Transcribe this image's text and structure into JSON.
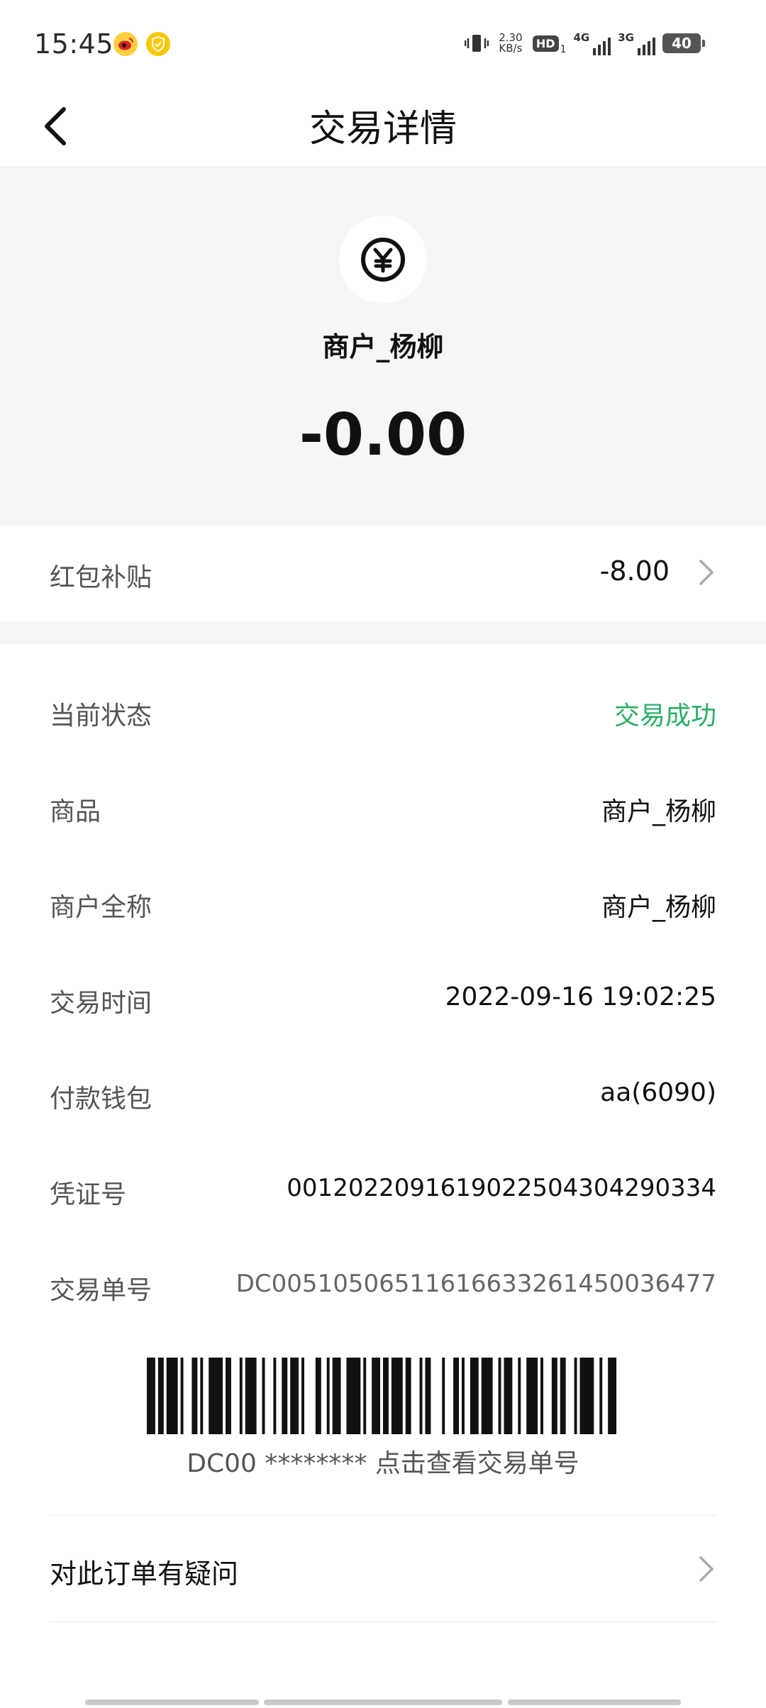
{
  "status_bar": {
    "time": "15:45",
    "net_speed_value": "2.30",
    "net_speed_unit": "KB/s",
    "hd_label": "HD",
    "hd_sub": "1",
    "signal1_label": "4G",
    "signal2_label": "3G",
    "battery": "40"
  },
  "nav": {
    "title": "交易详情",
    "back_icon": "chevron-left-icon"
  },
  "header": {
    "icon": "yuan-icon",
    "merchant": "商户_杨柳",
    "amount": "-0.00"
  },
  "subsidy": {
    "label": "红包补贴",
    "value": "-8.00"
  },
  "details": [
    {
      "label": "当前状态",
      "value": "交易成功"
    },
    {
      "label": "商品",
      "value": "商户_杨柳"
    },
    {
      "label": "商户全称",
      "value": "商户_杨柳"
    },
    {
      "label": "交易时间",
      "value": "2022-09-16 19:02:25"
    },
    {
      "label": "付款钱包",
      "value": "aa(6090)"
    },
    {
      "label": "凭证号",
      "value": "0012022091619022504304290334"
    },
    {
      "label": "交易单号",
      "value": "DC00510506511616633261450036477"
    }
  ],
  "barcode": {
    "caption": "DC00 ******** 点击查看交易单号"
  },
  "question": {
    "label": "对此订单有疑问"
  },
  "colors": {
    "success": "#2aae67",
    "header_bg": "#f5f6f7"
  }
}
